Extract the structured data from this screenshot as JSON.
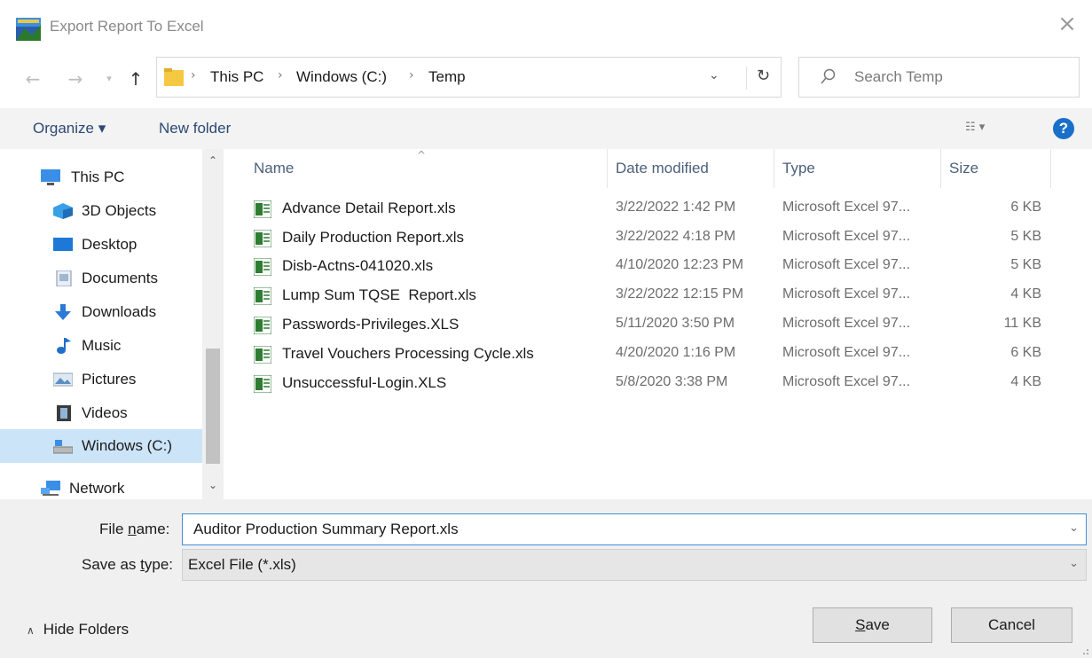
{
  "window": {
    "title": "Export Report To Excel"
  },
  "address": {
    "crumbs": [
      "This PC",
      "Windows (C:)",
      "Temp"
    ],
    "search_placeholder": "Search Temp"
  },
  "toolbar": {
    "organize": "Organize ▾",
    "new_folder": "New folder"
  },
  "nav": {
    "items": [
      {
        "label": "This PC",
        "icon": "monitor-icon"
      },
      {
        "label": "3D Objects",
        "icon": "cube-icon"
      },
      {
        "label": "Desktop",
        "icon": "desktop-icon"
      },
      {
        "label": "Documents",
        "icon": "document-icon"
      },
      {
        "label": "Downloads",
        "icon": "download-arrow-icon"
      },
      {
        "label": "Music",
        "icon": "music-note-icon"
      },
      {
        "label": "Pictures",
        "icon": "picture-icon"
      },
      {
        "label": "Videos",
        "icon": "film-icon"
      },
      {
        "label": "Windows (C:)",
        "icon": "drive-icon",
        "selected": true
      },
      {
        "label": "Network",
        "icon": "network-icon"
      }
    ]
  },
  "columns": {
    "name": "Name",
    "date": "Date modified",
    "type": "Type",
    "size": "Size"
  },
  "files": [
    {
      "name": "Advance Detail Report.xls",
      "date": "3/22/2022 1:42 PM",
      "type": "Microsoft Excel 97...",
      "size": "6 KB"
    },
    {
      "name": "Daily Production Report.xls",
      "date": "3/22/2022 4:18 PM",
      "type": "Microsoft Excel 97...",
      "size": "5 KB"
    },
    {
      "name": "Disb-Actns-041020.xls",
      "date": "4/10/2020 12:23 PM",
      "type": "Microsoft Excel 97...",
      "size": "5 KB"
    },
    {
      "name": "Lump Sum TQSE  Report.xls",
      "date": "3/22/2022 12:15 PM",
      "type": "Microsoft Excel 97...",
      "size": "4 KB"
    },
    {
      "name": "Passwords-Privileges.XLS",
      "date": "5/11/2020 3:50 PM",
      "type": "Microsoft Excel 97...",
      "size": "11 KB"
    },
    {
      "name": "Travel Vouchers Processing Cycle.xls",
      "date": "4/20/2020 1:16 PM",
      "type": "Microsoft Excel 97...",
      "size": "6 KB"
    },
    {
      "name": "Unsuccessful-Login.XLS",
      "date": "5/8/2020 3:38 PM",
      "type": "Microsoft Excel 97...",
      "size": "4 KB"
    }
  ],
  "form": {
    "filename_label_pre": "File ",
    "filename_label_ul": "n",
    "filename_label_post": "ame:",
    "filename_value": "Auditor Production Summary Report.xls",
    "savetype_label_pre": "Save as ",
    "savetype_label_ul": "t",
    "savetype_label_post": "ype:",
    "savetype_value": "Excel File (*.xls)"
  },
  "footer": {
    "hide_folders": "Hide Folders",
    "save_ul": "S",
    "save_rest": "ave",
    "cancel": "Cancel"
  },
  "colors": {
    "accent": "#1a6fc9",
    "selected_bg": "#cce4f7",
    "link": "#2b4a73"
  }
}
